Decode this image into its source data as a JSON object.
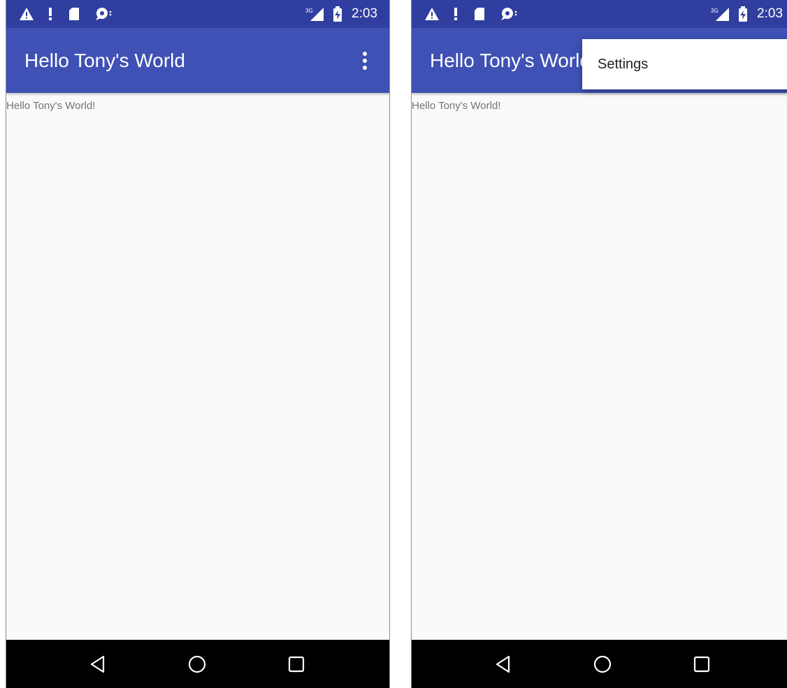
{
  "colors": {
    "status_bar": "#303f9f",
    "app_bar": "#3f51b5",
    "content_background": "#fafafa",
    "nav_bar": "#000000",
    "body_text": "#737373"
  },
  "screens": [
    {
      "status_bar": {
        "left_icons": [
          "warning-icon",
          "exclamation-icon",
          "sd-card-icon",
          "chat-bubble-icon"
        ],
        "right_icons": [
          "signal-3g-icon",
          "battery-charging-icon"
        ],
        "time": "2:03"
      },
      "app_bar": {
        "title": "Hello Tony's World",
        "overflow_icon": "more-vert-icon"
      },
      "body_text": "Hello Tony's World!",
      "nav_bar": [
        "back-icon",
        "home-icon",
        "recents-icon"
      ]
    },
    {
      "status_bar": {
        "left_icons": [
          "warning-icon",
          "exclamation-icon",
          "sd-card-icon",
          "chat-bubble-icon"
        ],
        "right_icons": [
          "signal-3g-icon",
          "battery-charging-icon"
        ],
        "time": "2:03"
      },
      "app_bar": {
        "title": "Hello Tony's World"
      },
      "overflow_menu": {
        "items": [
          {
            "label": "Settings"
          }
        ]
      },
      "body_text": "Hello Tony's World!",
      "nav_bar": [
        "back-icon",
        "home-icon",
        "recents-icon"
      ]
    }
  ]
}
